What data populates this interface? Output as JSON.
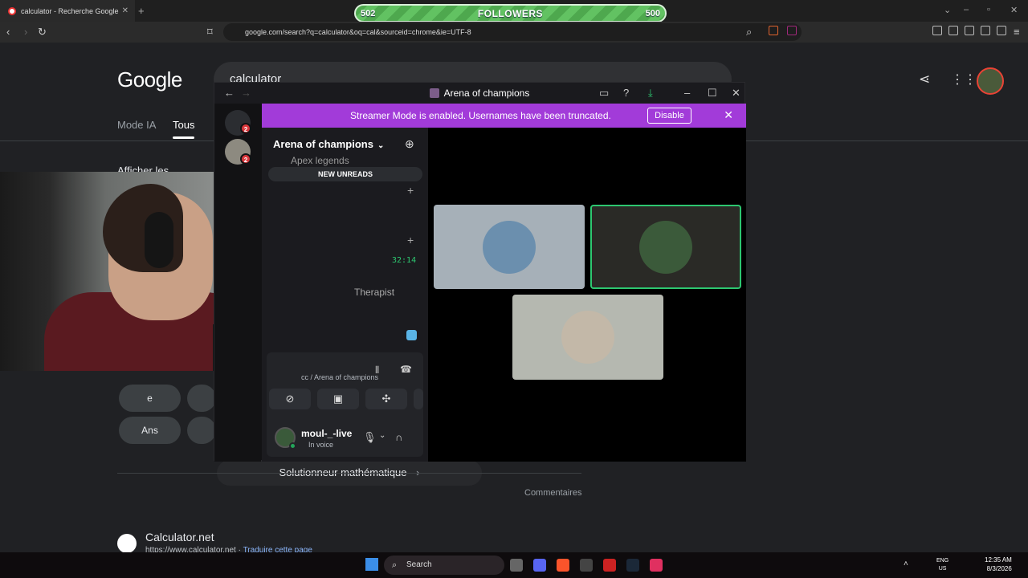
{
  "browser": {
    "tab_title": "calculator - Recherche Google",
    "url": "google.com/search?q=calculator&oq=cal&sourceid=chrome&ie=UTF-8",
    "tab_close": "✕",
    "new_tab": "+"
  },
  "overlay": {
    "followers_label": "FOLLOWERS",
    "followers_left": "502",
    "followers_right": "500"
  },
  "google": {
    "logo": "Google",
    "query": "calculator",
    "tabs": [
      "Mode IA",
      "Tous"
    ],
    "afficher": "Afficher les",
    "keys": [
      "e",
      "Ans"
    ],
    "solver_label": "Solutionneur mathématique",
    "comments": "Commentaires",
    "result_title": "Calculator.net",
    "result_url": "https://www.calculator.net",
    "result_translate": "Traduire cette page"
  },
  "discord": {
    "window_title": "Arena of champions",
    "banner_text": "Streamer Mode is enabled. Usernames have been truncated.",
    "banner_button": "Disable",
    "server_name": "Arena of champions",
    "channel_apex": "Apex legends",
    "new_unreads": "NEW UNREADS",
    "timer": "32:14",
    "therapist": "Therapist",
    "voice_status": "cc / Arena of champions",
    "username": "moul-_-live",
    "user_status": "In voice",
    "badges": [
      "2",
      "2"
    ],
    "colors": {
      "banner": "#a23bd9",
      "speaking_border": "#2dc770",
      "online": "#23a55a"
    }
  },
  "taskbar": {
    "search_label": "Search",
    "lang": "ENG",
    "region": "US",
    "time": "12:35 AM",
    "date": "8/3/2026"
  }
}
